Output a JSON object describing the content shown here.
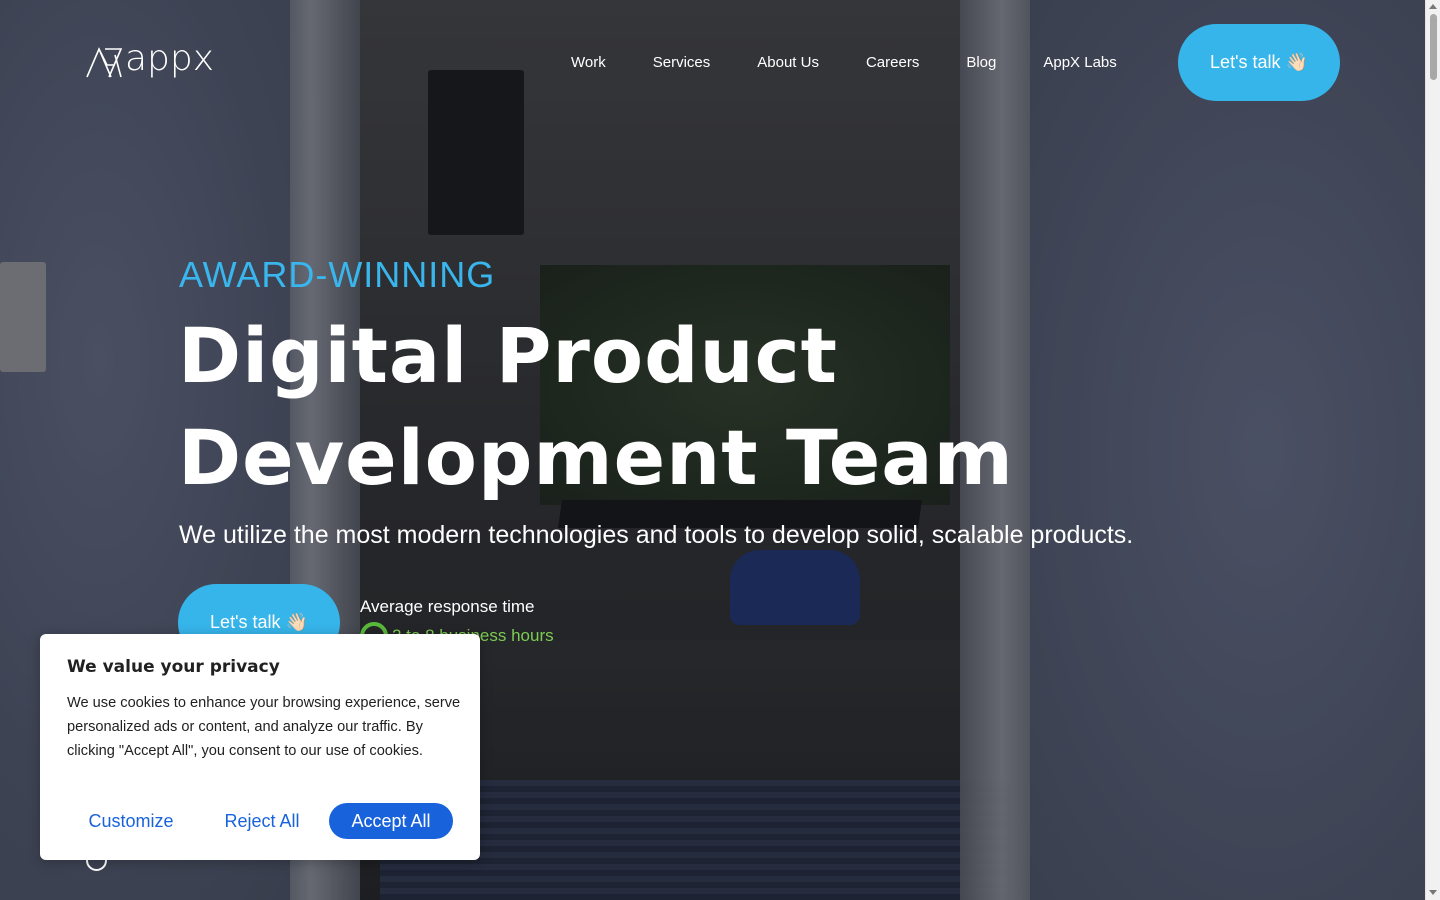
{
  "header": {
    "logo_text": "appx",
    "nav": [
      {
        "label": "Work"
      },
      {
        "label": "Services"
      },
      {
        "label": "About Us"
      },
      {
        "label": "Careers"
      },
      {
        "label": "Blog"
      },
      {
        "label": "AppX Labs"
      }
    ],
    "cta_label": "Let's talk 👋🏻"
  },
  "hero": {
    "eyebrow": "AWARD-WINNING",
    "headline_line1": "Digital Product",
    "headline_line2": "Development Team",
    "subline": "We utilize the most modern technologies and tools to develop solid, scalable products.",
    "cta_label": "Let's talk 👋🏻",
    "response_label": "Average response time",
    "response_value": "2 to 8 business hours"
  },
  "cookie_banner": {
    "title": "We value your privacy",
    "body": "We use cookies to enhance your browsing experience, serve personalized ads or content, and analyze our traffic. By clicking \"Accept All\", you consent to our use of cookies.",
    "customize_label": "Customize",
    "reject_label": "Reject All",
    "accept_label": "Accept All"
  },
  "colors": {
    "accent": "#36b5ea",
    "eyebrow": "#38b6ed",
    "response_green": "#7ccb52",
    "cookie_primary": "#1863dc"
  },
  "icons": {
    "logo": "appx-logo-mark",
    "response": "circle-ring-icon",
    "scroll": "scroll-circle-icon"
  }
}
